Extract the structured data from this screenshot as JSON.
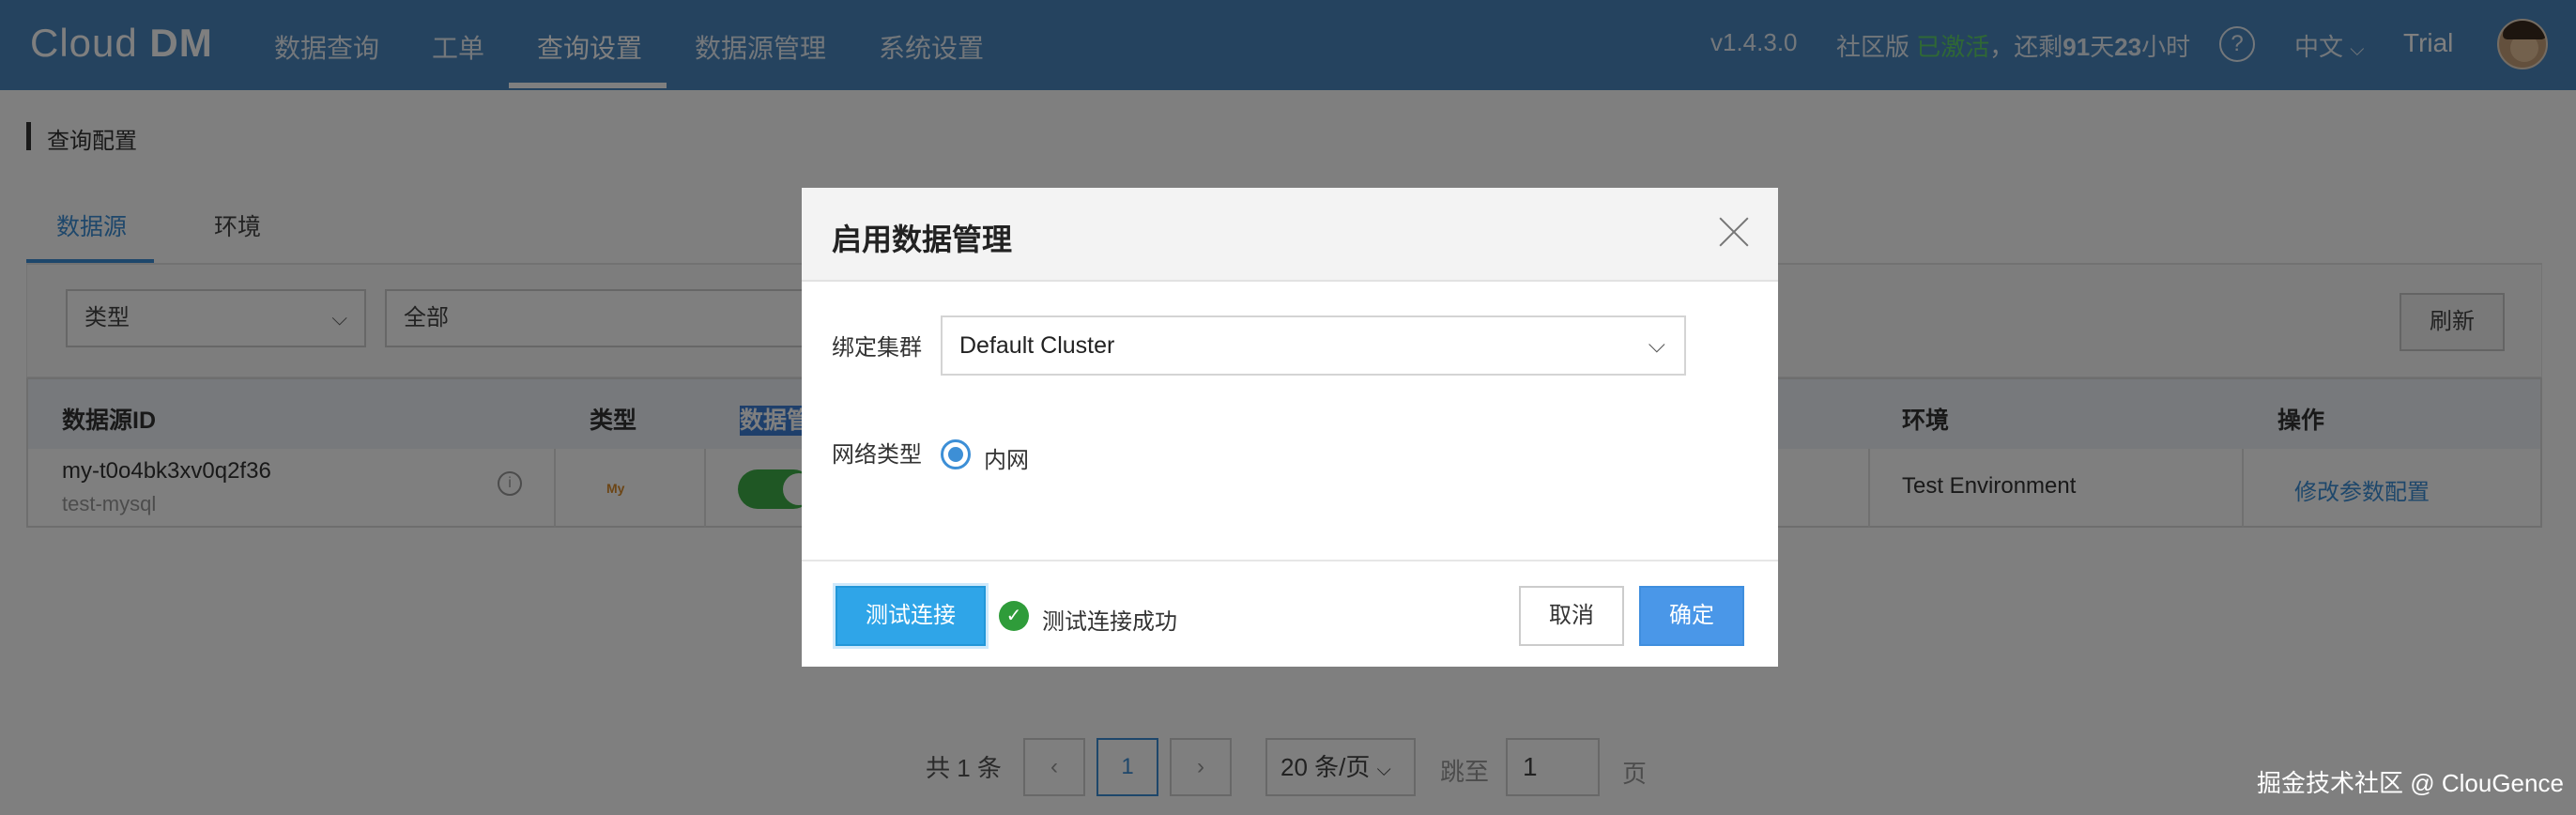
{
  "header": {
    "logo_light": "Cl",
    "logo_light2": "ud ",
    "logo_bold": "DM",
    "logo_o": "o",
    "nav": [
      "数据查询",
      "工单",
      "查询设置",
      "数据源管理",
      "系统设置"
    ],
    "active_nav": "查询设置",
    "version": "v1.4.3.0",
    "edition_prefix": "社区版",
    "edition_status": "已激活",
    "remaining_prefix": "，还剩",
    "remaining_days": "91",
    "days_unit": "天",
    "remaining_hours": "23",
    "hours_unit": "小时",
    "help": "?",
    "language": "中文",
    "language_chevron": "⌵",
    "user": "Trial"
  },
  "page": {
    "section_title": "查询配置",
    "tabs": [
      "数据源",
      "环境"
    ],
    "active_tab": "数据源",
    "filter": {
      "type_select": "类型",
      "all_select": "全部",
      "chevron": "⌵",
      "refresh_button": "刷新"
    },
    "table": {
      "headers": [
        "数据源ID",
        "类型",
        "数据管",
        "环境",
        "操作"
      ],
      "row": {
        "id": "my-t0o4bk3xv0q2f36",
        "desc": "test-mysql",
        "info": "i",
        "type_icon": "MySQL",
        "type_icon_text": "My",
        "env": "Test Environment",
        "action": "修改参数配置"
      }
    },
    "pagination": {
      "total": "共 1 条",
      "prev": "‹",
      "current": "1",
      "next": "›",
      "page_size": "20 条/页",
      "chevron": "⌵",
      "jump_label": "跳至",
      "jump_value": "1",
      "page_suffix": "页"
    }
  },
  "modal": {
    "title": "启用数据管理",
    "cluster_label": "绑定集群",
    "cluster_value": "Default Cluster",
    "chevron": "⌵",
    "network_label": "网络类型",
    "network_option": "内网",
    "test_button": "测试连接",
    "test_ok_icon": "✓",
    "test_result": "测试连接成功",
    "cancel_button": "取消",
    "ok_button": "确定"
  },
  "watermark": "掘金技术社区 @ ClouGence",
  "colors": {
    "nav_bg": "#4a87be",
    "accent": "#3d8fd6",
    "success": "#2f9c3a",
    "toggle_on": "#3fae49",
    "activated_text": "#5fd06a"
  }
}
